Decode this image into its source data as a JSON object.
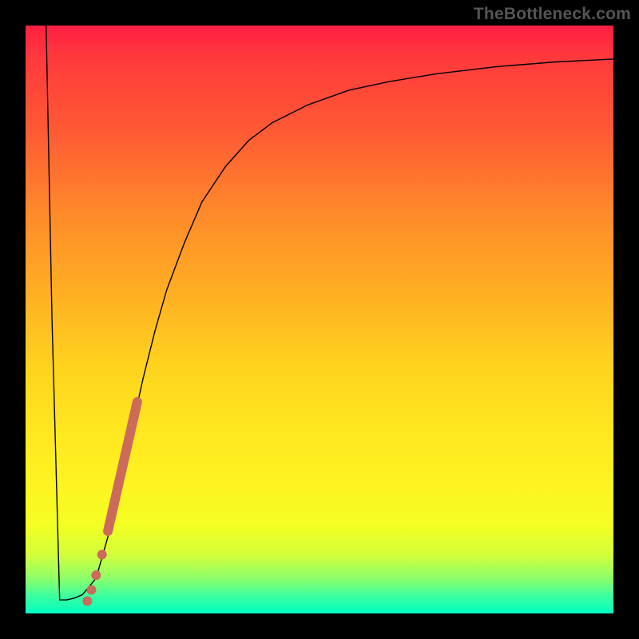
{
  "watermark": "TheBottleneck.com",
  "chart_data": {
    "type": "line",
    "title": "",
    "xlabel": "",
    "ylabel": "",
    "xlim": [
      0,
      100
    ],
    "ylim": [
      0,
      100
    ],
    "grid": false,
    "legend": false,
    "series": [
      {
        "name": "curve",
        "stroke": "#000000",
        "stroke_width": 1.4,
        "x": [
          3.5,
          4.5,
          5.8,
          7.0,
          8.3,
          9.7,
          12.0,
          14.0,
          16.0,
          18.0,
          20.0,
          22.0,
          24.0,
          27.0,
          30.0,
          34.0,
          38.0,
          42.0,
          48.0,
          55.0,
          62.0,
          70.0,
          80.0,
          90.0,
          100.0
        ],
        "y": [
          100.0,
          50.0,
          2.3,
          2.3,
          2.6,
          3.2,
          6.0,
          13.0,
          22.0,
          31.0,
          40.0,
          48.0,
          55.0,
          63.0,
          70.0,
          76.0,
          80.5,
          83.5,
          86.5,
          89.0,
          90.5,
          91.8,
          93.0,
          93.8,
          94.3
        ]
      },
      {
        "name": "highlight-band",
        "stroke": "#cc6b5a",
        "stroke_width": 12,
        "linecap": "round",
        "x": [
          14.0,
          19.0
        ],
        "y": [
          14.0,
          36.0
        ]
      }
    ],
    "markers": [
      {
        "name": "dot",
        "x": 13.0,
        "y": 10.0,
        "r": 6,
        "fill": "#cc6b5a"
      },
      {
        "name": "dot",
        "x": 12.0,
        "y": 6.5,
        "r": 6,
        "fill": "#cc6b5a"
      },
      {
        "name": "dot",
        "x": 11.2,
        "y": 4.0,
        "r": 6,
        "fill": "#cc6b5a"
      },
      {
        "name": "dot",
        "x": 10.5,
        "y": 2.1,
        "r": 6,
        "fill": "#cc6b5a"
      }
    ]
  }
}
